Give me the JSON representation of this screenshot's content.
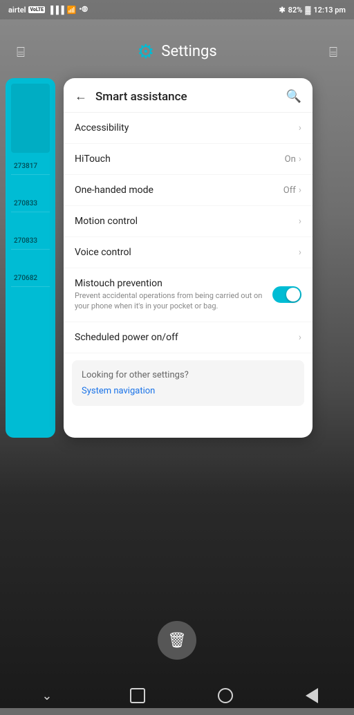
{
  "statusBar": {
    "carrier": "airtel",
    "volte": "VoLTE",
    "batteryPercent": "82%",
    "time": "12:13 pm"
  },
  "settingsHeader": {
    "title": "Settings",
    "leftIconName": "grid-icon",
    "rightIconName": "grid-icon"
  },
  "smartAssistanceCard": {
    "backLabel": "←",
    "title": "Smart assistance",
    "searchIconName": "search-icon",
    "menuItems": [
      {
        "id": "accessibility",
        "label": "Accessibility",
        "value": "",
        "sublabel": "",
        "hasChevron": true,
        "hasToggle": false
      },
      {
        "id": "hitouch",
        "label": "HiTouch",
        "value": "On",
        "sublabel": "",
        "hasChevron": true,
        "hasToggle": false
      },
      {
        "id": "one-handed-mode",
        "label": "One-handed mode",
        "value": "Off",
        "sublabel": "",
        "hasChevron": true,
        "hasToggle": false
      },
      {
        "id": "motion-control",
        "label": "Motion control",
        "value": "",
        "sublabel": "",
        "hasChevron": true,
        "hasToggle": false
      },
      {
        "id": "voice-control",
        "label": "Voice control",
        "value": "",
        "sublabel": "",
        "hasChevron": true,
        "hasToggle": false
      },
      {
        "id": "mistouch-prevention",
        "label": "Mistouch prevention",
        "value": "",
        "sublabel": "Prevent accidental operations from being carried out on your phone when it's in your pocket or bag.",
        "hasChevron": false,
        "hasToggle": true,
        "toggleOn": true
      },
      {
        "id": "scheduled-power",
        "label": "Scheduled power on/off",
        "value": "",
        "sublabel": "",
        "hasChevron": true,
        "hasToggle": false
      }
    ],
    "otherSettings": {
      "label": "Looking for other settings?",
      "linkText": "System navigation"
    }
  },
  "leftCard": {
    "rows": [
      "",
      "273817",
      "",
      "270833",
      "",
      "270833",
      "",
      "270682"
    ]
  },
  "bottomNav": {
    "downLabel": "▼",
    "homeLabel": "",
    "circleLabel": "",
    "backLabel": ""
  },
  "trashButton": {
    "iconName": "trash-icon"
  }
}
